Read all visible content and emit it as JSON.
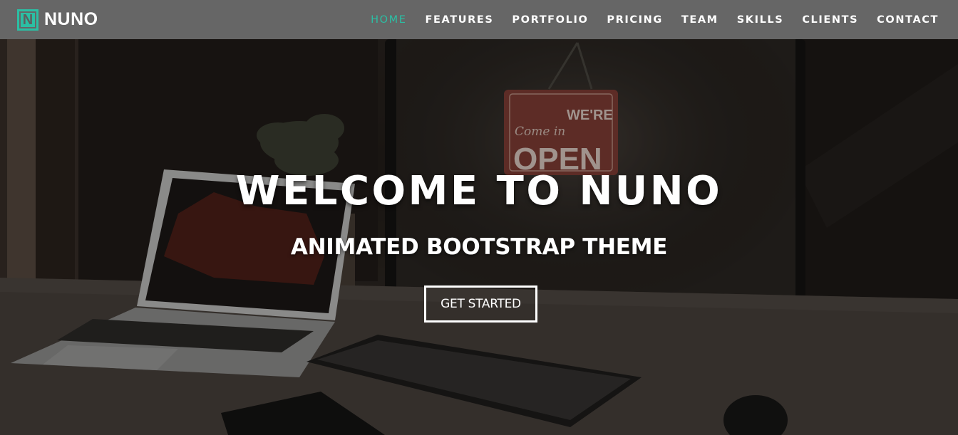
{
  "navbar": {
    "brand": {
      "logo_letter": "N",
      "name": "NUNO",
      "accent_color": "#2bbfa4"
    },
    "background_color": "#666666",
    "items": [
      {
        "label": "HOME",
        "active": true
      },
      {
        "label": "FEATURES",
        "active": false
      },
      {
        "label": "PORTFOLIO",
        "active": false
      },
      {
        "label": "PRICING",
        "active": false
      },
      {
        "label": "TEAM",
        "active": false
      },
      {
        "label": "SKILLS",
        "active": false
      },
      {
        "label": "CLIENTS",
        "active": false
      },
      {
        "label": "CONTACT",
        "active": false
      }
    ]
  },
  "hero": {
    "title": "WELCOME TO NUNO",
    "subtitle": "ANIMATED BOOTSTRAP THEME",
    "cta_label": "GET STARTED",
    "background_image": "laptop-desk-photo",
    "sign_text_line1": "Come in WE'RE",
    "sign_text_line2": "OPEN"
  }
}
